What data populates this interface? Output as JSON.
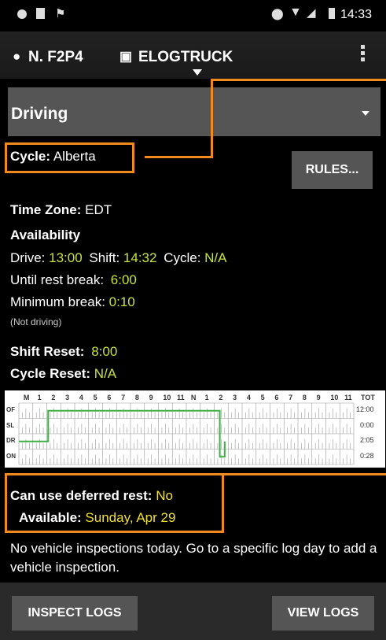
{
  "status_bar": {
    "time": "14:33"
  },
  "header": {
    "driver": "N. F2P4",
    "truck": "ELOGTRUCK"
  },
  "status_dropdown": {
    "selected": "Driving"
  },
  "cycle": {
    "label": "Cycle:",
    "value": "Alberta"
  },
  "rules_button": "RULES...",
  "time_zone": {
    "label": "Time Zone:",
    "value": "EDT"
  },
  "availability": {
    "heading": "Availability",
    "drive_label": "Drive:",
    "drive_value": "13:00",
    "shift_label": "Shift:",
    "shift_value": "14:32",
    "cycle_label": "Cycle:",
    "cycle_value": "N/A",
    "rest_label": "Until rest break:",
    "rest_value": "6:00",
    "min_label": "Minimum break:",
    "min_value": "0:10",
    "note": "(Not driving)"
  },
  "shift_reset": {
    "label": "Shift Reset:",
    "value": "8:00"
  },
  "cycle_reset": {
    "label": "Cycle Reset:",
    "value": "N/A"
  },
  "log_grid": {
    "hour_labels": [
      "M",
      "1",
      "2",
      "3",
      "4",
      "5",
      "6",
      "7",
      "8",
      "9",
      "10",
      "11",
      "N",
      "1",
      "2",
      "3",
      "4",
      "5",
      "6",
      "7",
      "8",
      "9",
      "10",
      "11"
    ],
    "tot_label": "TOT",
    "rows": [
      {
        "label": "OF",
        "total": "12:00"
      },
      {
        "label": "SL",
        "total": "0:00"
      },
      {
        "label": "DR",
        "total": "2:05"
      },
      {
        "label": "ON",
        "total": "0:28"
      }
    ]
  },
  "deferred": {
    "label": "Can use deferred rest:",
    "value": "No",
    "available_label": "Available:",
    "available_value": "Sunday, Apr 29"
  },
  "inspection_message": "No vehicle inspections today. Go to a specific log day to add a vehicle inspection.",
  "footer": {
    "inspect_logs": "INSPECT LOGS",
    "view_logs": "VIEW LOGS"
  },
  "colors": {
    "accent": "#f08a1c",
    "value_yellow": "#c8e23c",
    "grid_line": "#3cb043"
  }
}
